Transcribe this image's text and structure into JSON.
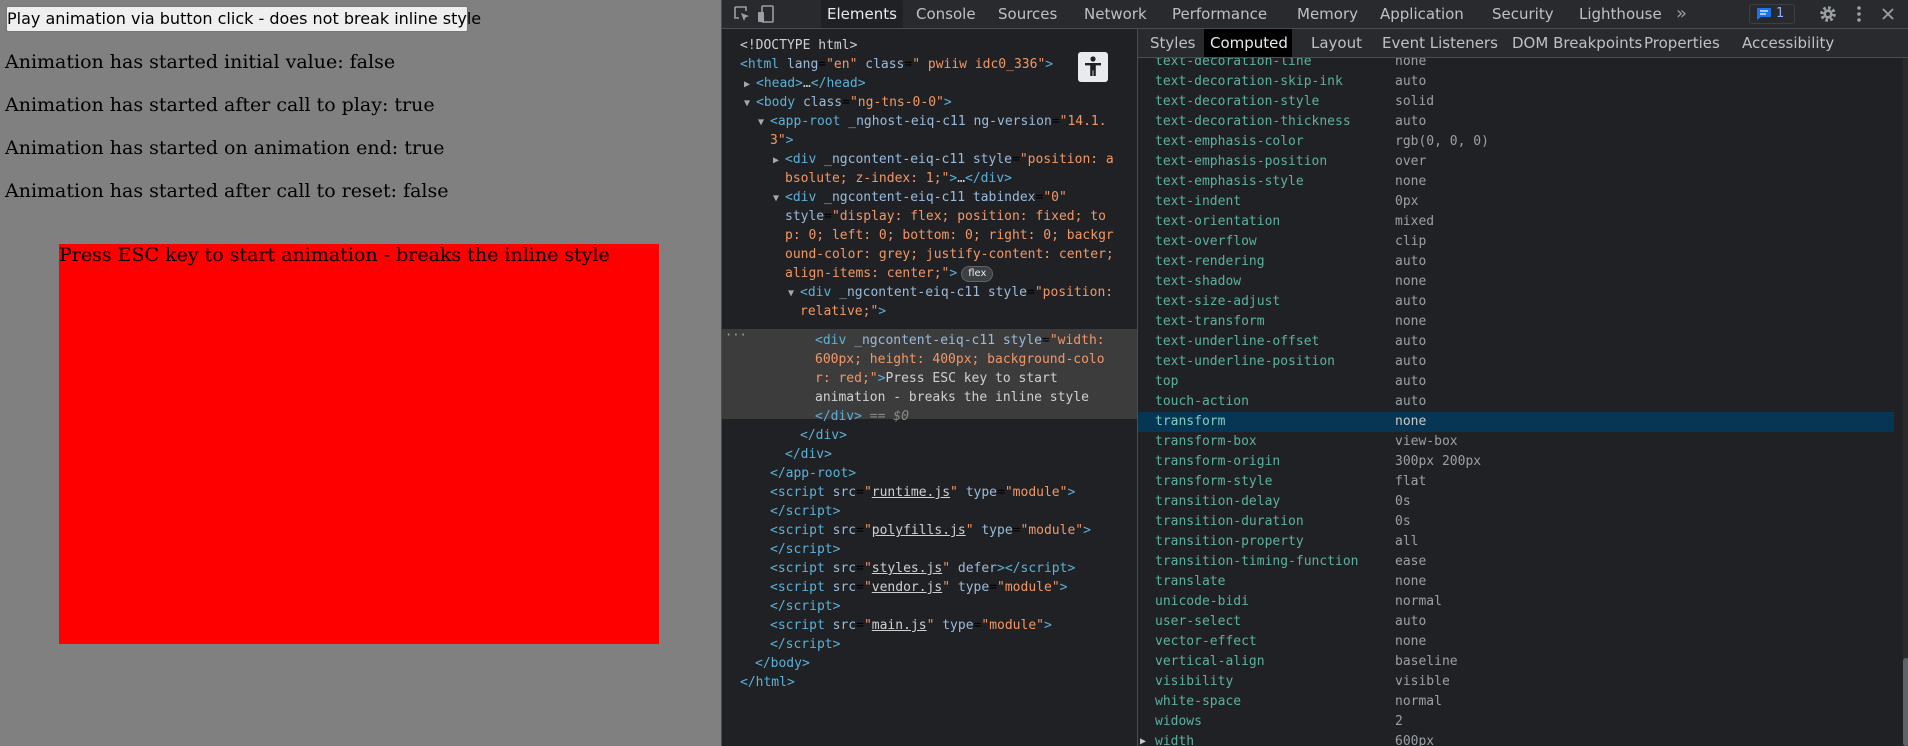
{
  "page": {
    "play_button": "Play animation via button click - does not break inline style",
    "status_lines": [
      "Animation has started initial value: false",
      "Animation has started after call to play: true",
      "Animation has started on animation end: true",
      "Animation has started after call to reset: false"
    ],
    "box_text": "Press ESC key to start animation - breaks the inline style",
    "box_color": "#ff0000",
    "background_color": "#808080"
  },
  "devtools": {
    "main_tabs": [
      "Elements",
      "Console",
      "Sources",
      "Network",
      "Performance",
      "Memory",
      "Application",
      "Security",
      "Lighthouse"
    ],
    "active_main_tab": "Elements",
    "more_tabs_glyph": "»",
    "issues_count": "1",
    "icons": [
      "inspect-icon",
      "device-toolbar-icon",
      "issues-icon",
      "settings-gear-icon",
      "kebab-menu-icon",
      "close-icon",
      "accessibility-icon"
    ],
    "side_tabs": [
      "Styles",
      "Computed",
      "Layout",
      "Event Listeners",
      "DOM Breakpoints",
      "Properties",
      "Accessibility"
    ],
    "active_side_tab": "Computed",
    "dom_tree": {
      "doctype": "<!DOCTYPE html>",
      "html_open": [
        "<html",
        "lang",
        "\"en\"",
        "class",
        "\" pwiiw idc0_336\"",
        ">"
      ],
      "head": [
        "<head>",
        "…",
        "</head>"
      ],
      "body_open": [
        "<body",
        "class",
        "\"ng-tns-0-0\"",
        ">"
      ],
      "app_root_open": [
        "<app-root",
        "_nghost-eiq-c11",
        "ng-version",
        "\"14.1.",
        "3\"",
        ">"
      ],
      "div1": [
        "<div",
        "_ngcontent-eiq-c11",
        "style",
        "\"position: a",
        "bsolute; z-index: 1;\"",
        ">",
        "…",
        "</div>"
      ],
      "div2": [
        "<div",
        "_ngcontent-eiq-c11",
        "tabindex",
        "\"0\"",
        "style",
        "\"display: flex; position: fixed; to",
        "p: 0; left: 0; bottom: 0; right: 0; backgr",
        "ound-color: grey; justify-content: center;",
        "align-items: center;\"",
        ">",
        "flex"
      ],
      "div3": [
        "<div",
        "_ngcontent-eiq-c11",
        "style",
        "\"position:",
        "relative;\"",
        ">"
      ],
      "div4": [
        "<div",
        "_ngcontent-eiq-c11",
        "style",
        "\"width:",
        "600px; height: 400px; background-colo",
        "r: red;\"",
        ">",
        "Press ESC key to start",
        "animation - breaks the inline style",
        "</div>",
        "== $0"
      ],
      "close_div": "</div>",
      "close_app_root": "</app-root>",
      "scripts": [
        {
          "src": "runtime.js",
          "type": "module",
          "close_on_next": true
        },
        {
          "src": "polyfills.js",
          "type": "module",
          "close_on_next": true
        },
        {
          "src": "styles.js",
          "defer": true,
          "close_on_next": false
        },
        {
          "src": "vendor.js",
          "type": "module",
          "close_on_next": true
        },
        {
          "src": "main.js",
          "type": "module",
          "close_on_next": true
        }
      ],
      "close_body": "</body>",
      "close_html": "</html>",
      "ellipsis": "···"
    },
    "computed_properties": [
      {
        "name": "text-decoration-line",
        "value": "none"
      },
      {
        "name": "text-decoration-skip-ink",
        "value": "auto"
      },
      {
        "name": "text-decoration-style",
        "value": "solid"
      },
      {
        "name": "text-decoration-thickness",
        "value": "auto"
      },
      {
        "name": "text-emphasis-color",
        "value": "rgb(0, 0, 0)"
      },
      {
        "name": "text-emphasis-position",
        "value": "over"
      },
      {
        "name": "text-emphasis-style",
        "value": "none"
      },
      {
        "name": "text-indent",
        "value": "0px"
      },
      {
        "name": "text-orientation",
        "value": "mixed"
      },
      {
        "name": "text-overflow",
        "value": "clip"
      },
      {
        "name": "text-rendering",
        "value": "auto"
      },
      {
        "name": "text-shadow",
        "value": "none"
      },
      {
        "name": "text-size-adjust",
        "value": "auto"
      },
      {
        "name": "text-transform",
        "value": "none"
      },
      {
        "name": "text-underline-offset",
        "value": "auto"
      },
      {
        "name": "text-underline-position",
        "value": "auto"
      },
      {
        "name": "top",
        "value": "auto"
      },
      {
        "name": "touch-action",
        "value": "auto"
      },
      {
        "name": "transform",
        "value": "none",
        "highlighted": true
      },
      {
        "name": "transform-box",
        "value": "view-box"
      },
      {
        "name": "transform-origin",
        "value": "300px 200px"
      },
      {
        "name": "transform-style",
        "value": "flat"
      },
      {
        "name": "transition-delay",
        "value": "0s"
      },
      {
        "name": "transition-duration",
        "value": "0s"
      },
      {
        "name": "transition-property",
        "value": "all"
      },
      {
        "name": "transition-timing-function",
        "value": "ease"
      },
      {
        "name": "translate",
        "value": "none"
      },
      {
        "name": "unicode-bidi",
        "value": "normal"
      },
      {
        "name": "user-select",
        "value": "auto"
      },
      {
        "name": "vector-effect",
        "value": "none"
      },
      {
        "name": "vertical-align",
        "value": "baseline"
      },
      {
        "name": "visibility",
        "value": "visible"
      },
      {
        "name": "white-space",
        "value": "normal"
      },
      {
        "name": "widows",
        "value": "2"
      },
      {
        "name": "width",
        "value": "600px",
        "expandable": true
      }
    ]
  }
}
